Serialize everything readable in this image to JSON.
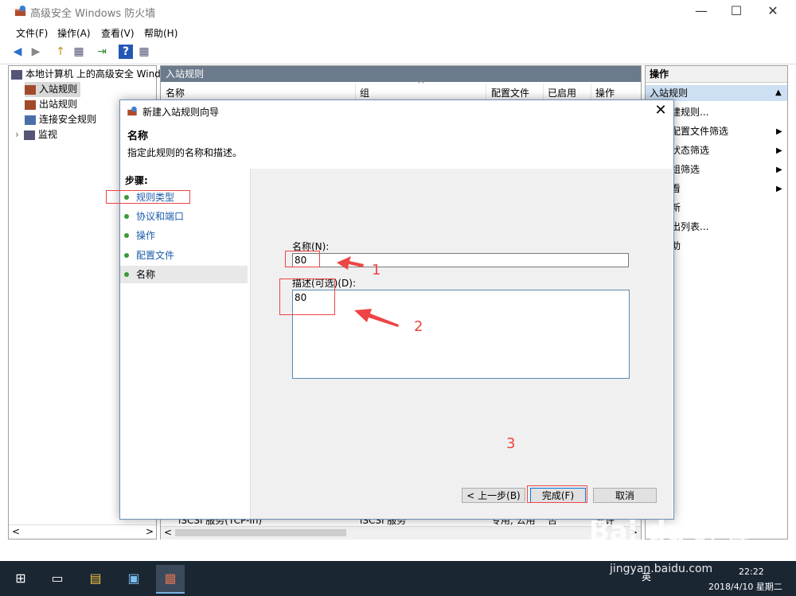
{
  "window": {
    "title": "高级安全 Windows 防火墙",
    "min_glyph": "—",
    "max_glyph": "☐",
    "close_glyph": "✕"
  },
  "menu": [
    "文件(F)",
    "操作(A)",
    "查看(V)",
    "帮助(H)"
  ],
  "toolbar_glyphs": [
    "◀",
    "▶",
    "↑",
    "▦",
    "⇥",
    "?",
    "▦"
  ],
  "tree": {
    "root": "本地计算机 上的高级安全 Windows",
    "items": [
      "入站规则",
      "出站规则",
      "连接安全规则",
      "监视"
    ]
  },
  "center": {
    "header": "入站规则",
    "columns": [
      "名称",
      "组",
      "配置文件",
      "已启用",
      "操作"
    ],
    "partial_row": {
      "name": "iSCSI 服务(TCP-In)",
      "group": "iSCSI 服务",
      "profile": "专用, 公用",
      "enabled": "否",
      "action": "允许"
    }
  },
  "actions": {
    "header": "操作",
    "section": "入站规则",
    "items": [
      "新建规则...",
      "按配置文件筛选",
      "按状态筛选",
      "按组筛选",
      "查看",
      "刷新",
      "导出列表...",
      "帮助"
    ],
    "submenu_arrow": "▶",
    "collapse_arrow": "▲"
  },
  "dialog": {
    "title": "新建入站规则向导",
    "heading": "名称",
    "subtitle": "指定此规则的名称和描述。",
    "steps_label": "步骤:",
    "steps": [
      "规则类型",
      "协议和端口",
      "操作",
      "配置文件",
      "名称"
    ],
    "name_label": "名称(N):",
    "name_value": "80",
    "desc_label": "描述(可选)(D):",
    "desc_value": "80",
    "back_button": "< 上一步(B)",
    "finish_button": "完成(F)",
    "cancel_button": "取消",
    "close_glyph": "✕"
  },
  "annotations": [
    "1",
    "2",
    "3"
  ],
  "taskbar": {
    "start_glyph": "⊞",
    "icons": [
      "▭",
      "▤",
      "▣",
      "▩"
    ],
    "ime": "英",
    "time": "22:22",
    "date": "2018/4/10 星期二"
  },
  "watermark": {
    "brand": "Bai du 经验",
    "url": "jingyan.baidu.com"
  },
  "scroll": {
    "left": "<",
    "right": ">",
    "up": "^"
  },
  "colors": {
    "accent": "#0078d7",
    "header": "#6b7b8c",
    "annotation": "#e44444",
    "selected": "#cde0f3"
  }
}
